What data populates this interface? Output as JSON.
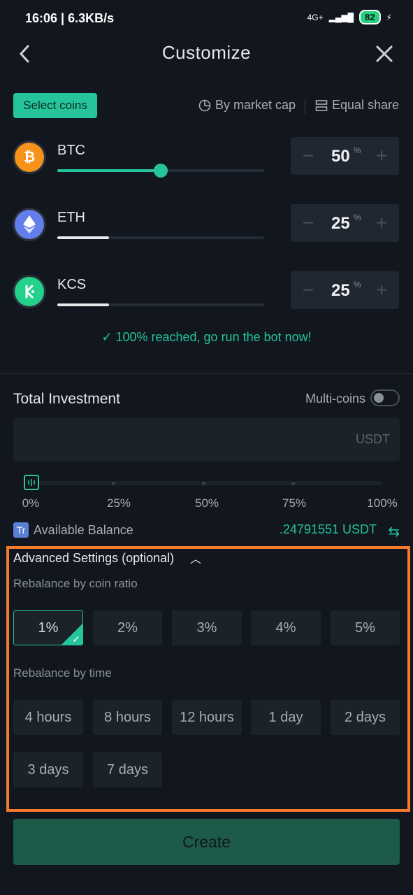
{
  "status_bar": {
    "time_speed": "16:06 | 6.3KB/s",
    "network": "4G+",
    "battery": "82"
  },
  "header": {
    "title": "Customize",
    "back_icon": "chevron-left-icon",
    "close_icon": "close-icon"
  },
  "toolbar": {
    "select_coins": "Select coins",
    "by_market_cap": "By market cap",
    "equal_share": "Equal share"
  },
  "coins": [
    {
      "symbol": "BTC",
      "percent": "50",
      "share": 0.5,
      "color": "#f7931a"
    },
    {
      "symbol": "ETH",
      "percent": "25",
      "share": 0.25,
      "color": "#627eea"
    },
    {
      "symbol": "KCS",
      "percent": "25",
      "share": 0.25,
      "color": "#23d18b"
    }
  ],
  "percent_sign": "%",
  "reached_message": "100% reached, go run the bot now!",
  "investment": {
    "title": "Total Investment",
    "multi_coins_label": "Multi-coins",
    "multi_coins_on": false,
    "unit": "USDT",
    "percent_labels": [
      "0%",
      "25%",
      "50%",
      "75%",
      "100%"
    ],
    "percent_value": 0,
    "available_label": "Available Balance",
    "available_value": ".24791551 USDT"
  },
  "advanced": {
    "title": "Advanced Settings (optional)",
    "ratio_label": "Rebalance by coin ratio",
    "ratio_options": [
      "1%",
      "2%",
      "3%",
      "4%",
      "5%"
    ],
    "ratio_selected": "1%",
    "time_label": "Rebalance by time",
    "time_options": [
      "4 hours",
      "8 hours",
      "12 hours",
      "1 day",
      "2 days",
      "3 days",
      "7 days"
    ]
  },
  "create_label": "Create",
  "colors": {
    "accent": "#25c49a",
    "highlight": "#f57a2b",
    "background": "#11161f"
  }
}
